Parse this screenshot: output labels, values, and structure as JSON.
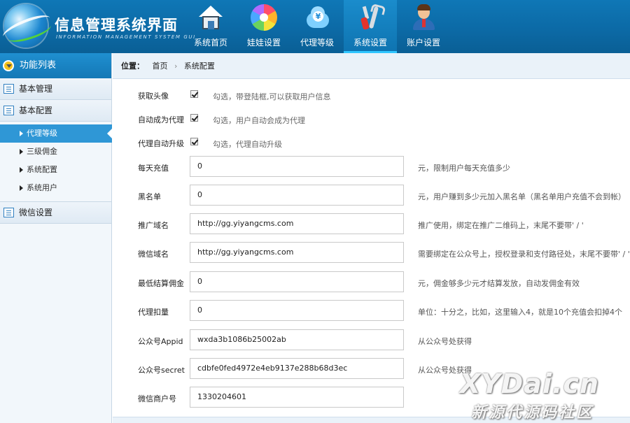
{
  "header": {
    "title": "信息管理系统界面",
    "subtitle": "INFORMATION MANAGEMENT SYSTEM GUI",
    "nav": [
      {
        "label": "系统首页",
        "icon": "home-icon"
      },
      {
        "label": "娃娃设置",
        "icon": "pinwheel-icon"
      },
      {
        "label": "代理等级",
        "icon": "cloud-yen-icon"
      },
      {
        "label": "系统设置",
        "icon": "tools-icon",
        "active": true
      },
      {
        "label": "账户设置",
        "icon": "user-icon"
      }
    ]
  },
  "sidebar": {
    "title": "功能列表",
    "groups": [
      {
        "label": "基本管理"
      },
      {
        "label": "基本配置",
        "items": [
          "代理等级",
          "三级佣金",
          "系统配置",
          "系统用户"
        ],
        "active_item": "代理等级"
      },
      {
        "label": "微信设置"
      }
    ]
  },
  "breadcrumb": {
    "label": "位置：",
    "items": [
      "首页",
      "系统配置"
    ]
  },
  "form": {
    "checkboxes": [
      {
        "label": "获取头像",
        "checked": true,
        "hint": "勾选，带登陆框,可以获取用户信息"
      },
      {
        "label": "自动成为代理",
        "checked": true,
        "hint": "勾选，用户自动会成为代理"
      },
      {
        "label": "代理自动升级",
        "checked": true,
        "hint": "勾选，代理自动升级"
      }
    ],
    "fields": [
      {
        "label": "每天充值",
        "value": "0",
        "hint": "元，限制用户每天充值多少"
      },
      {
        "label": "黑名单",
        "value": "0",
        "hint": "元，用户赚到多少元加入黑名单（黑名单用户充值不会到帐）"
      },
      {
        "label": "推广域名",
        "value": "http://gg.yiyangcms.com",
        "hint": "推广使用，绑定在推广二维码上，末尾不要带' / '"
      },
      {
        "label": "微信域名",
        "value": "http://gg.yiyangcms.com",
        "hint": "需要绑定在公众号上，授权登录和支付路径处，末尾不要带' / '"
      },
      {
        "label": "最低结算佣金",
        "value": "0",
        "hint": "元，佣金够多少元才结算发放，自动发佣金有效"
      },
      {
        "label": "代理扣量",
        "value": "0",
        "hint": "单位：十分之，比如，这里输入4，就是10个充值会扣掉4个"
      },
      {
        "label": "公众号Appid",
        "value": "wxda3b1086b25002ab",
        "hint": "从公众号处获得"
      },
      {
        "label": "公众号secret",
        "value": "cdbfe0fed4972e4eb9137e288b68d3ec",
        "hint": "从公众号处获得"
      },
      {
        "label": "微信商户号",
        "value": "1330204601",
        "hint": ""
      }
    ]
  },
  "watermark": {
    "line1": "XYDai.cn",
    "line2": "新源代源码社区"
  }
}
